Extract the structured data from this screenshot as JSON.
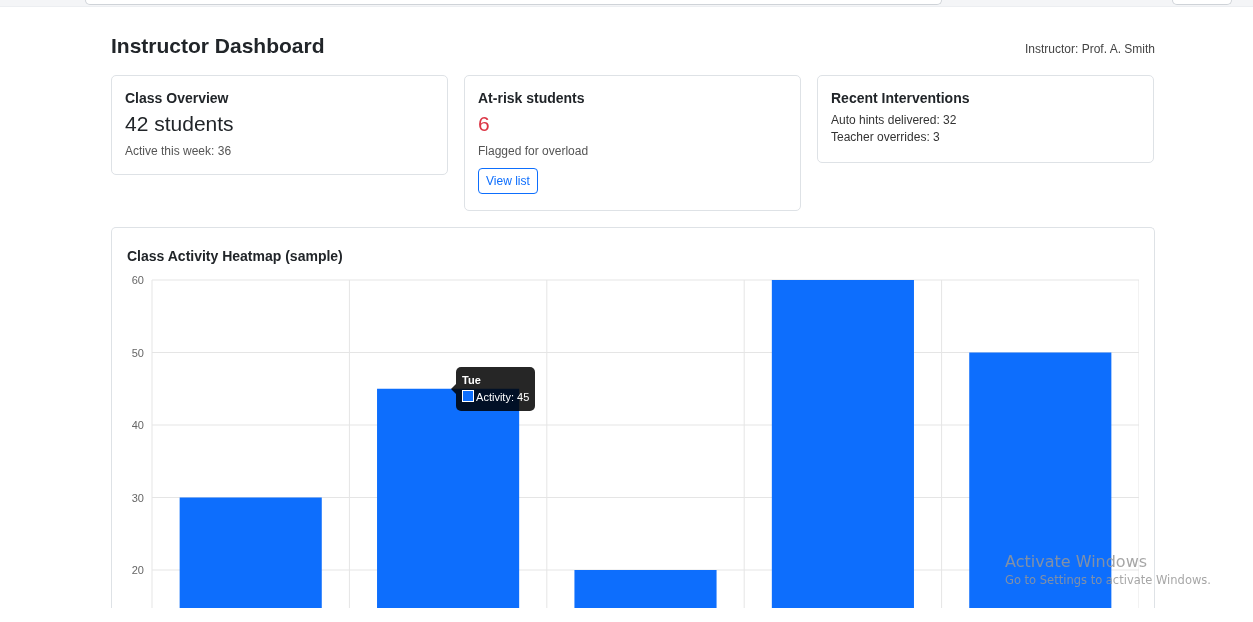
{
  "header": {
    "title": "Instructor Dashboard",
    "instructor": "Instructor: Prof. A. Smith"
  },
  "cards": [
    {
      "kind": "count",
      "title": "Class Overview",
      "value": "42 students",
      "note": "Active this week: 36"
    },
    {
      "kind": "alert",
      "title": "At-risk students",
      "value": "6",
      "note": "Flagged for overload",
      "button": "View list"
    },
    {
      "kind": "list",
      "title": "Recent Interventions",
      "lines": [
        "Auto hints delivered: 32",
        "Teacher overrides: 3"
      ]
    }
  ],
  "chart": {
    "title": "Class Activity Heatmap (sample)",
    "chart_data": {
      "type": "bar",
      "series": [
        {
          "color": "#0d6efd",
          "values": [
            30,
            45,
            20,
            60,
            50
          ]
        }
      ],
      "ylim": [
        0,
        60
      ],
      "yticks": [
        20,
        30,
        40,
        50,
        60
      ],
      "grid": true
    },
    "tooltip": {
      "title": "Tue",
      "label": "Activity: 45",
      "color": "#0d6efd"
    }
  },
  "os_notice": {
    "title": "Activate Windows",
    "text": "Go to Settings to activate Windows."
  }
}
